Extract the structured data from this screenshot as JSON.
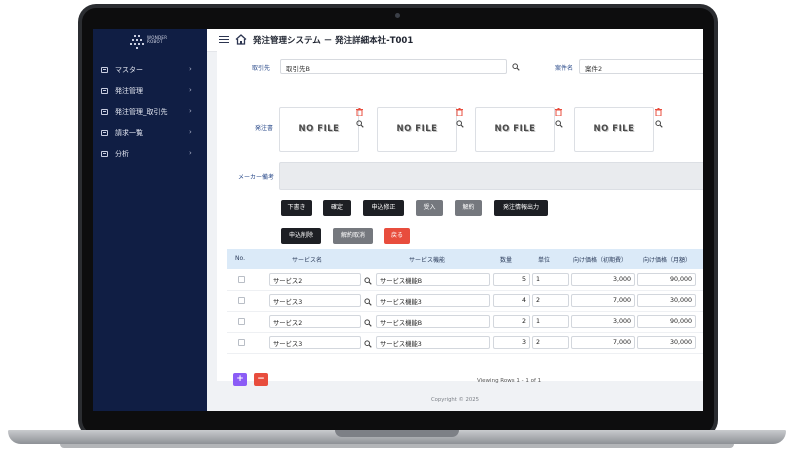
{
  "app": {
    "logo_text_line1": "WONDER",
    "logo_text_line2": "ROBOT",
    "title": "発注管理システム － 発注詳細本社-T001"
  },
  "sidebar": {
    "items": [
      {
        "label": "マスター"
      },
      {
        "label": "発注管理"
      },
      {
        "label": "発注管理_取引先"
      },
      {
        "label": "請求一覧"
      },
      {
        "label": "分析"
      }
    ]
  },
  "form": {
    "supplier_label": "取引先",
    "supplier_value": "取引先B",
    "case_label": "案件名",
    "case_value": "案件2",
    "order_doc_label": "発注書",
    "nofile_text": "NO FILE",
    "maker_memo_label": "メーカー備考"
  },
  "buttons": {
    "row1": [
      "下書き",
      "確定",
      "申込修正",
      "受入",
      "解約",
      "発注情報出力"
    ],
    "row2": [
      "申込削除",
      "解約取消",
      "戻る"
    ]
  },
  "table": {
    "headers": [
      "No.",
      "サービス名",
      "サービス機能",
      "数量",
      "単位",
      "向け価格（初期費）",
      "向け価格（月額）"
    ],
    "rows": [
      {
        "service": "サービス2",
        "function": "サービス機能B",
        "qty": "5",
        "unit": "1",
        "initial": "3,000",
        "monthly": "90,000"
      },
      {
        "service": "サービス3",
        "function": "サービス機能3",
        "qty": "4",
        "unit": "2",
        "initial": "7,000",
        "monthly": "30,000"
      },
      {
        "service": "サービス2",
        "function": "サービス機能B",
        "qty": "2",
        "unit": "1",
        "initial": "3,000",
        "monthly": "90,000"
      },
      {
        "service": "サービス3",
        "function": "サービス機能3",
        "qty": "3",
        "unit": "2",
        "initial": "7,000",
        "monthly": "30,000"
      }
    ],
    "add_label": "+",
    "remove_label": "−",
    "viewing": "Viewing Rows 1 - 1 of 1"
  },
  "footer": "Copyright © 2025",
  "colors": {
    "sidebar": "#101e44",
    "primary_dark": "#1d1f24",
    "gray_button": "#75787e",
    "danger": "#e84d3d",
    "add_button": "#8b5cf6",
    "table_header": "#dbeaf8",
    "label_blue": "#2a4a8a"
  }
}
